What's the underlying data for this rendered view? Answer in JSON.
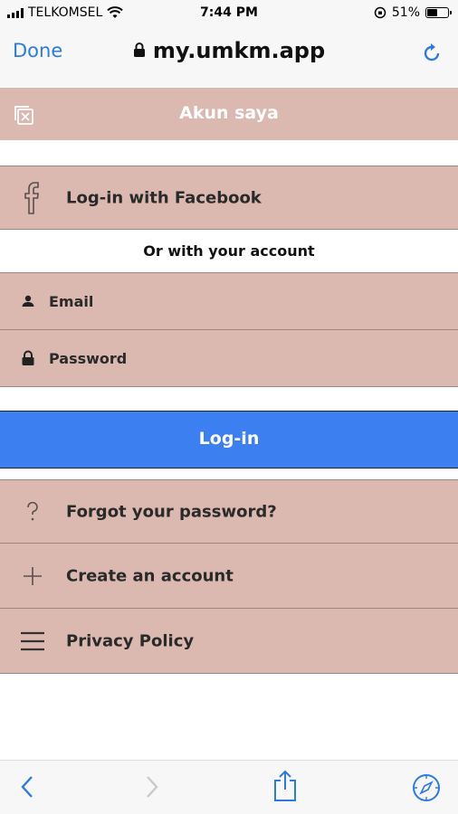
{
  "status_bar": {
    "carrier": "TELKOMSEL",
    "time": "7:44 PM",
    "battery_percent": "51%",
    "battery_level": 0.51
  },
  "browser": {
    "done_label": "Done",
    "url": "my.umkm.app"
  },
  "app": {
    "title": "Akun saya"
  },
  "login": {
    "facebook_label": "Log-in with Facebook",
    "divider_text": "Or with your account",
    "email_placeholder": "Email",
    "password_placeholder": "Password",
    "login_button": "Log-in"
  },
  "links": [
    {
      "label": "Forgot your password?",
      "icon": "question-icon"
    },
    {
      "label": "Create an account",
      "icon": "plus-icon"
    },
    {
      "label": "Privacy Policy",
      "icon": "menu-icon"
    }
  ],
  "colors": {
    "accent_blue": "#3b7ff0",
    "row_background": "#dbb8b0",
    "ios_blue": "#2c7be5"
  }
}
